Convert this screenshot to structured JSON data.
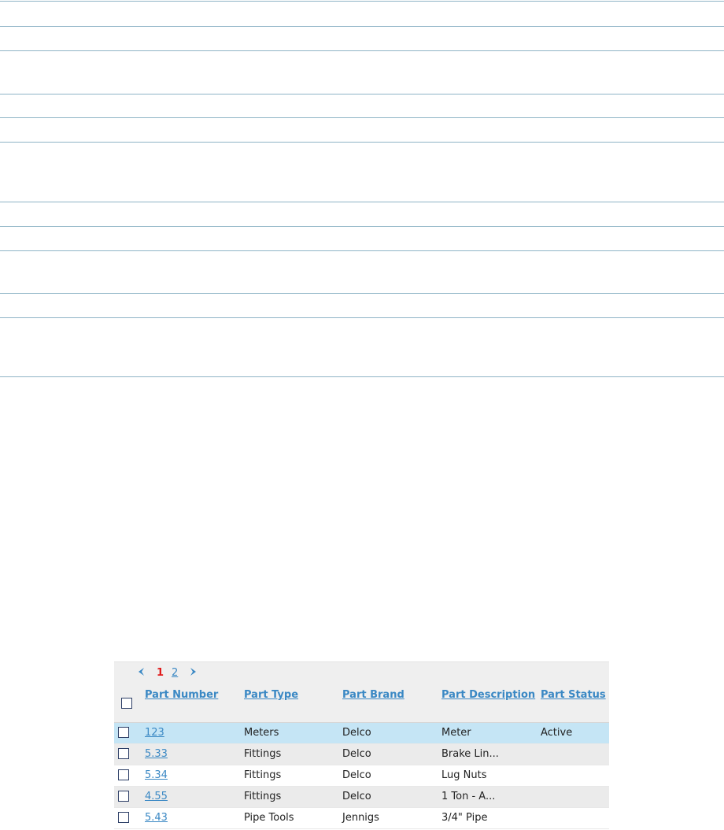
{
  "pager": {
    "prev_icon": "chevron-left-icon",
    "current_page": "1",
    "next_page": "2",
    "next_icon": "chevron-right-icon"
  },
  "colors": {
    "accent": "#3a88c4",
    "current_page": "#e01b1b",
    "row_selected": "#c5e5f5",
    "row_alt": "#ebebeb",
    "rule": "#8fb4c6"
  },
  "table": {
    "columns": [
      "Part Number",
      "Part Type",
      "Part Brand",
      "Part Description",
      "Part Status"
    ],
    "rows": [
      {
        "part_number": "123 ",
        "part_type": "Meters",
        "part_brand": "Delco",
        "part_description": "Meter",
        "part_status": "Active",
        "selected": true
      },
      {
        "part_number": "5.33 ",
        "part_type": "Fittings",
        "part_brand": "Delco",
        "part_description": "Brake Lin...",
        "part_status": "",
        "selected": false
      },
      {
        "part_number": "5.34 ",
        "part_type": "Fittings",
        "part_brand": "Delco",
        "part_description": "Lug Nuts",
        "part_status": "",
        "selected": false
      },
      {
        "part_number": "4.55 ",
        "part_type": "Fittings",
        "part_brand": "Delco",
        "part_description": "1 Ton - A...",
        "part_status": "",
        "selected": false
      },
      {
        "part_number": "5.43 ",
        "part_type": "Pipe Tools",
        "part_brand": "Jennigs",
        "part_description": "3/4\" Pipe",
        "part_status": "",
        "selected": false
      }
    ]
  }
}
